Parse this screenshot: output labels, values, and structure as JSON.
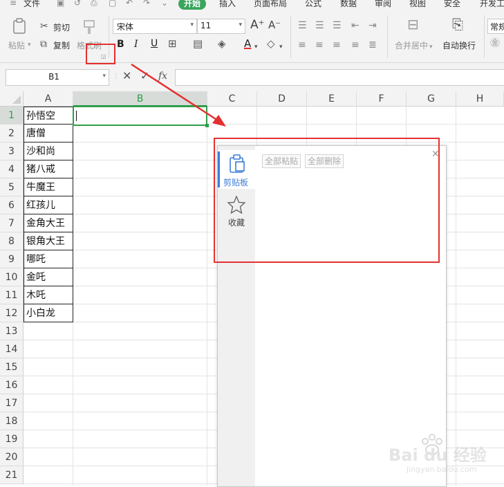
{
  "menu": {
    "items": [
      "文件",
      "开始",
      "插入",
      "页面布局",
      "公式",
      "数据",
      "审阅",
      "视图",
      "安全",
      "开发工"
    ],
    "active": "开始"
  },
  "ribbon": {
    "paste": "粘贴",
    "cut": "剪切",
    "copy": "复制",
    "format_painter": "格式刷",
    "font_name": "宋体",
    "font_size": "11",
    "merge_center": "合并居中",
    "wrap_text": "自动换行",
    "number_format": "常规"
  },
  "formula_bar": {
    "name_box": "B1",
    "fx_label": "fx",
    "formula": ""
  },
  "sheet": {
    "columns": [
      "A",
      "B",
      "C",
      "D",
      "E",
      "F",
      "G",
      "H"
    ],
    "selected_column": "B",
    "rows": [
      "1",
      "2",
      "3",
      "4",
      "5",
      "6",
      "7",
      "8",
      "9",
      "10",
      "11",
      "12",
      "13",
      "14",
      "15",
      "16",
      "17",
      "18",
      "19",
      "20",
      "21"
    ],
    "selected_row": "1",
    "active_cell": "B1",
    "col_a_values": [
      "孙悟空",
      "唐僧",
      "沙和尚",
      "猪八戒",
      "牛魔王",
      "红孩儿",
      "金角大王",
      "银角大王",
      "哪吒",
      "金吒",
      "木吒",
      "小白龙"
    ]
  },
  "clipboard_pane": {
    "tabs": [
      {
        "label": "剪贴板",
        "icon": "clipboard-icon",
        "active": true
      },
      {
        "label": "收藏",
        "icon": "star-icon",
        "active": false
      }
    ],
    "paste_all": "全部粘贴",
    "delete_all": "全部删除"
  },
  "watermark": {
    "brand": "Bai du 经验",
    "url": "jingyan.baidu.com"
  },
  "colors": {
    "accent_green": "#2e9e4a",
    "annotation_red": "#e53030",
    "active_tab_blue": "#3b7cd8"
  }
}
